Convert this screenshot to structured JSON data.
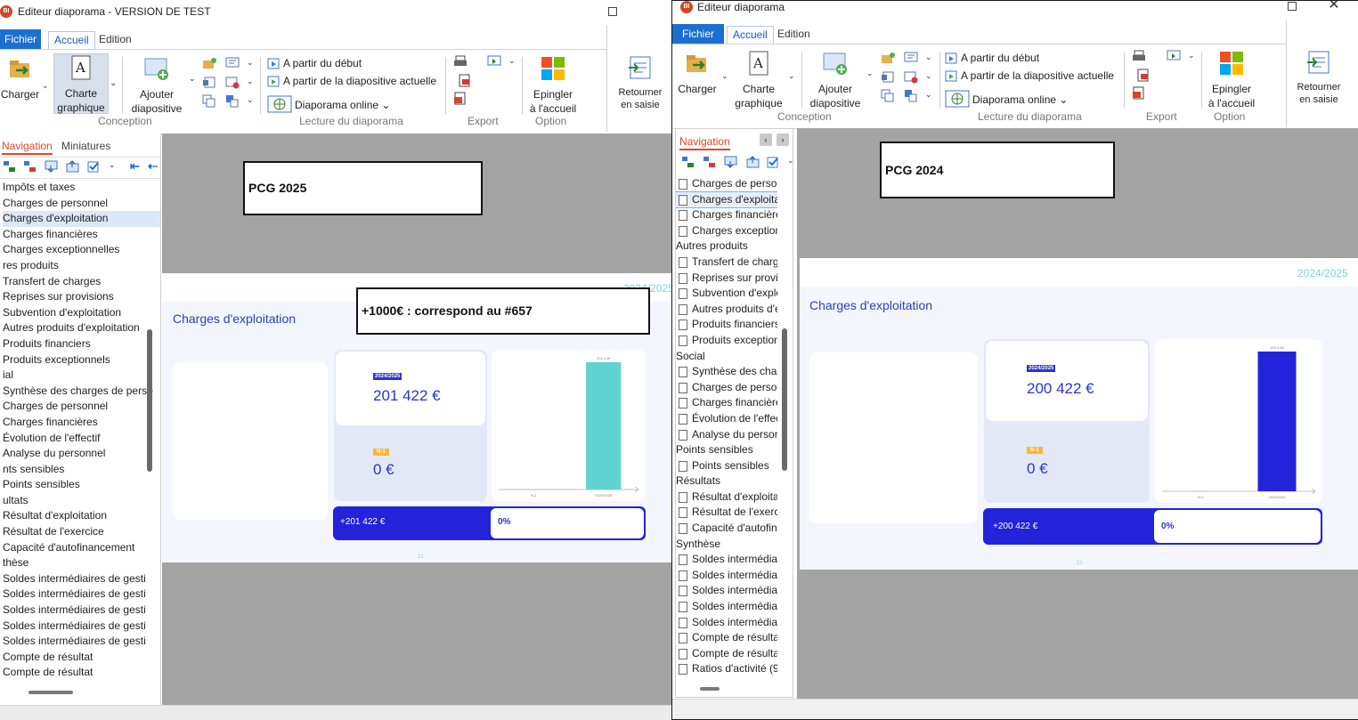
{
  "window_left": {
    "title": "Editeur diaporama - VERSION DE TEST",
    "app_icon_text": "BI",
    "tabs": {
      "file": "Fichier",
      "home": "Accueil",
      "edit": "Edition"
    },
    "ribbon": {
      "charger": "Charger",
      "charte_line1": "Charte",
      "charte_line2": "graphique",
      "ajouter_line1": "Ajouter",
      "ajouter_line2": "diapositive",
      "group_conception": "Conception",
      "start": "A partir du début",
      "current": "A partir de la diapositive actuelle",
      "online": "Diaporama online",
      "group_lecture": "Lecture du diaporama",
      "group_export": "Export",
      "epingler_line1": "Epingler",
      "epingler_line2": "à l'accueil",
      "group_option": "Option",
      "retourner_line1": "Retourner",
      "retourner_line2": "en saisie"
    },
    "nav": {
      "tab_navigation": "Navigation",
      "tab_miniatures": "Miniatures",
      "items": [
        "Impôts et taxes",
        "Charges de personnel",
        "Charges d'exploitation",
        "Charges financières",
        "Charges exceptionnelles",
        "res produits",
        "Transfert de charges",
        "Reprises sur provisions",
        "Subvention d'exploitation",
        "Autres produits d'exploitation",
        "Produits financiers",
        "Produits exceptionnels",
        "ial",
        "Synthèse des charges de perso",
        "Charges de personnel",
        "Charges financières",
        "Évolution de l'effectif",
        "Analyse du personnel",
        "nts sensibles",
        "Points sensibles",
        "ultats",
        "Résultat d'exploitation",
        "Résultat de l'exercice",
        "Capacité d'autofinancement",
        "thèse",
        "Soldes intermédiaires de gesti",
        "Soldes intermédiaires de gesti",
        "Soldes intermédiaires de gesti",
        "Soldes intermédiaires de gesti",
        "Soldes intermédiaires de gesti",
        "Compte de résultat",
        "Compte de résultat"
      ]
    },
    "slide": {
      "year": "2024/2025",
      "heading": "Charges d'exploitation",
      "badge_current": "2024/2025",
      "value_current": "201 422 €",
      "badge_prev": "N-1",
      "value_prev": "0 €",
      "delta": "+201 422 €",
      "pct": "0%",
      "page": "21",
      "bar_color": "#5fd3d0"
    },
    "chart_data": {
      "type": "bar",
      "categories": [
        "N-1",
        "2024/2025"
      ],
      "values": [
        0,
        201.4
      ],
      "data_labels": [
        "",
        "201,4 k€"
      ],
      "ylim": [
        0,
        201.4
      ]
    },
    "annotations": {
      "pcg": "PCG 2025",
      "note": "+1000€ : correspond au #657"
    }
  },
  "window_right": {
    "title": "Editeur diaporama",
    "app_icon_text": "BI",
    "tabs": {
      "file": "Fichier",
      "home": "Accueil",
      "edit": "Edition"
    },
    "ribbon": {
      "charger": "Charger",
      "charte_line1": "Charte",
      "charte_line2": "graphique",
      "ajouter_line1": "Ajouter",
      "ajouter_line2": "diapositive",
      "group_conception": "Conception",
      "start": "A partir du début",
      "current": "A partir de la diapositive actuelle",
      "online": "Diaporama online",
      "group_lecture": "Lecture du diaporama",
      "group_export": "Export",
      "epingler_line1": "Epingler",
      "epingler_line2": "à l'accueil",
      "group_option": "Option",
      "retourner_line1": "Retourner",
      "retourner_line2": "en saisie"
    },
    "nav": {
      "tab_navigation": "Navigation",
      "items": [
        {
          "t": "Charges de person",
          "leaf": true
        },
        {
          "t": "Charges d'exploita",
          "leaf": true,
          "sel": true
        },
        {
          "t": "Charges financière",
          "leaf": true
        },
        {
          "t": "Charges exception",
          "leaf": true
        },
        {
          "t": "Autres produits",
          "leaf": false
        },
        {
          "t": "Transfert de charg",
          "leaf": true
        },
        {
          "t": "Reprises sur provis",
          "leaf": true
        },
        {
          "t": "Subvention d'explo",
          "leaf": true
        },
        {
          "t": "Autres produits d'e",
          "leaf": true
        },
        {
          "t": "Produits financiers",
          "leaf": true
        },
        {
          "t": "Produits exception",
          "leaf": true
        },
        {
          "t": "Social",
          "leaf": false
        },
        {
          "t": "Synthèse des charg",
          "leaf": true
        },
        {
          "t": "Charges de person",
          "leaf": true
        },
        {
          "t": "Charges financière",
          "leaf": true
        },
        {
          "t": "Évolution de l'effec",
          "leaf": true
        },
        {
          "t": "Analyse du person",
          "leaf": true
        },
        {
          "t": "Points sensibles",
          "leaf": false
        },
        {
          "t": "Points sensibles",
          "leaf": true
        },
        {
          "t": "Résultats",
          "leaf": false
        },
        {
          "t": "Résultat d'exploita",
          "leaf": true
        },
        {
          "t": "Résultat de l'exerc",
          "leaf": true
        },
        {
          "t": "Capacité d'autofin",
          "leaf": true
        },
        {
          "t": "Synthèse",
          "leaf": false
        },
        {
          "t": "Soldes intermédiai",
          "leaf": true
        },
        {
          "t": "Soldes intermédiai",
          "leaf": true
        },
        {
          "t": "Soldes intermédiai",
          "leaf": true
        },
        {
          "t": "Soldes intermédiai",
          "leaf": true
        },
        {
          "t": "Soldes intermédiai",
          "leaf": true
        },
        {
          "t": "Compte de résulta",
          "leaf": true
        },
        {
          "t": "Compte de résulta",
          "leaf": true
        },
        {
          "t": "Ratios d'activité (9",
          "leaf": true
        }
      ]
    },
    "slide": {
      "year": "2024/2025",
      "heading": "Charges d'exploitation",
      "badge_current": "2024/2025",
      "value_current": "200 422 €",
      "badge_prev": "N-1",
      "value_prev": "0 €",
      "delta": "+200 422 €",
      "pct": "0%",
      "page": "21",
      "bar_color": "#2323d9"
    },
    "chart_data": {
      "type": "bar",
      "categories": [
        "N-1",
        "2024/2025"
      ],
      "values": [
        0,
        200.4
      ],
      "data_labels": [
        "",
        "200,4 k€"
      ],
      "ylim": [
        0,
        200.4
      ]
    },
    "annotations": {
      "pcg": "PCG 2024"
    }
  }
}
